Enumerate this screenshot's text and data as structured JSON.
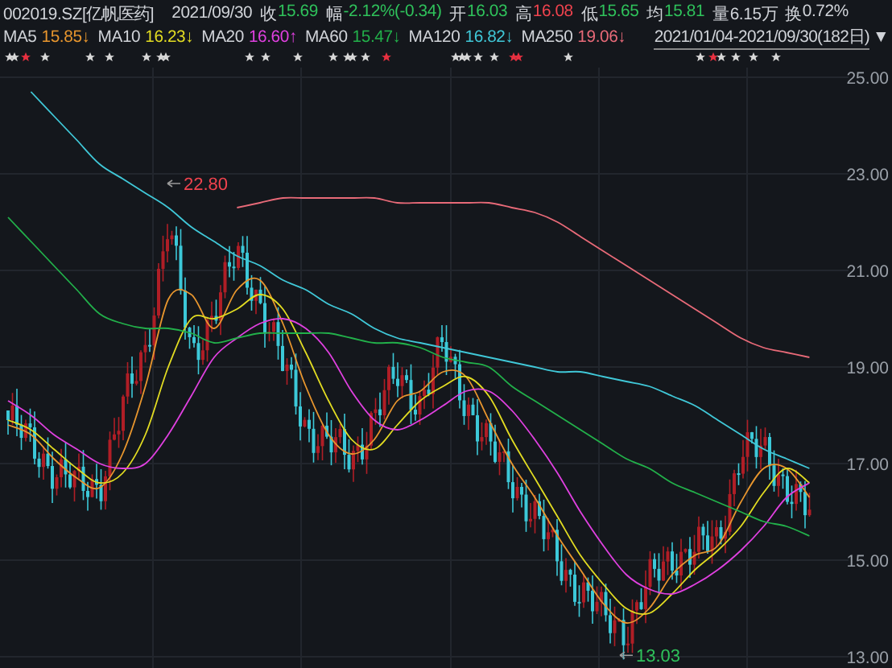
{
  "quote": {
    "symbol": "002019.SZ[亿帆医药]",
    "date": "2021/09/30",
    "fields": [
      {
        "label": "收",
        "value": "15.69",
        "color": "#2fc25b"
      },
      {
        "label": "幅",
        "value": "-2.12%(-0.34)",
        "color": "#2fc25b"
      },
      {
        "label": "开",
        "value": "16.03",
        "color": "#2fc25b"
      },
      {
        "label": "高",
        "value": "16.08",
        "color": "#f0434e"
      },
      {
        "label": "低",
        "value": "15.65",
        "color": "#2fc25b"
      },
      {
        "label": "均",
        "value": "15.81",
        "color": "#2fc25b"
      },
      {
        "label": "量",
        "value": "6.15万",
        "color": "#d0d3d8"
      },
      {
        "label": "换",
        "value": "0.72%",
        "color": "#d0d3d8"
      }
    ]
  },
  "moving_averages": [
    {
      "value": "15.85↓",
      "color": "#e8962e"
    },
    {
      "value": "16.23↓",
      "color": "#e2dc22"
    },
    {
      "value": "16.60↑",
      "color": "#e040e0"
    },
    {
      "value": "15.47↓",
      "color": "#22b04a"
    },
    {
      "value": "16.82↓",
      "color": "#40c8d8"
    },
    {
      "value": "19.06↓",
      "color": "#e86a78"
    }
  ],
  "date_range": {
    "label": "2021/01/04-2021/09/30(182日)",
    "dropdown": "▼"
  },
  "event_markers": [
    {
      "color": "#d8d8d8"
    },
    {
      "color": "#d8d8d8"
    },
    {
      "color": "#e83040"
    },
    {
      "color": "#d8d8d8"
    },
    {
      "color": "#d8d8d8"
    },
    {
      "color": "#d8d8d8"
    },
    {
      "color": "#d8d8d8"
    },
    {
      "color": "#d8d8d8"
    },
    {
      "color": "#d8d8d8"
    },
    {
      "color": "#d8d8d8"
    },
    {
      "color": "#d8d8d8"
    },
    {
      "color": "#d8d8d8"
    },
    {
      "color": "#d8d8d8"
    },
    {
      "color": "#d8d8d8"
    },
    {
      "color": "#d8d8d8"
    },
    {
      "color": "#d8d8d8"
    },
    {
      "color": "#e83040"
    },
    {
      "color": "#d8d8d8"
    },
    {
      "color": "#d8d8d8"
    },
    {
      "color": "#d8d8d8"
    },
    {
      "color": "#d8d8d8"
    },
    {
      "color": "#d8d8d8"
    },
    {
      "color": "#e83040"
    },
    {
      "color": "#e83040"
    },
    {
      "color": "#d8d8d8"
    },
    {
      "color": "#d8d8d8"
    },
    {
      "color": "#e83040"
    },
    {
      "color": "#d8d8d8"
    },
    {
      "color": "#d8d8d8"
    },
    {
      "color": "#d8d8d8"
    },
    {
      "color": "#d8d8d8"
    }
  ],
  "chart": {
    "high_label": "22.80",
    "low_label": "13.03",
    "chart_data": {
      "type": "line",
      "categories": [
        null,
        null,
        null,
        null,
        null,
        null,
        null,
        null,
        null,
        null,
        null,
        null,
        null,
        null,
        null,
        null,
        null,
        null,
        null,
        null,
        null,
        null,
        null,
        null,
        null,
        null,
        null,
        null,
        null,
        null,
        null,
        null,
        null,
        null,
        null,
        null
      ],
      "ylim": [
        13,
        25
      ],
      "grid": true,
      "yticks": [
        {
          "value": 25,
          "label": "25.00"
        },
        {
          "value": 23,
          "label": "23.00"
        },
        {
          "value": 21,
          "label": "21.00"
        },
        {
          "value": 19,
          "label": "19.00"
        },
        {
          "value": 17,
          "label": "17.00"
        },
        {
          "value": 15,
          "label": "15.00"
        },
        {
          "value": 13,
          "label": "13.00"
        }
      ],
      "series": [
        {
          "name": "MA5",
          "color": "#e8962e",
          "values": [
            17.8,
            17.6,
            17.1,
            16.7,
            16.5,
            17.2,
            18.6,
            20.4,
            20.5,
            19.8,
            20.6,
            20.8,
            19.9,
            18.6,
            17.6,
            17.2,
            17.5,
            18.3,
            18.5,
            18.9,
            18.8,
            17.9,
            17.0,
            16.3,
            15.5,
            14.8,
            14.1,
            13.7,
            14.0,
            14.7,
            15.1,
            15.3,
            16.2,
            16.9,
            16.9,
            16.3
          ]
        },
        {
          "name": "MA10",
          "color": "#e2dc22",
          "values": [
            17.9,
            17.7,
            17.3,
            16.9,
            16.6,
            16.8,
            17.6,
            19.0,
            20.0,
            20.0,
            20.2,
            20.5,
            20.2,
            19.3,
            18.3,
            17.5,
            17.3,
            17.8,
            18.3,
            18.6,
            18.8,
            18.4,
            17.5,
            16.7,
            15.9,
            15.1,
            14.5,
            14.0,
            13.9,
            14.3,
            14.8,
            15.2,
            15.7,
            16.4,
            16.9,
            16.6
          ]
        },
        {
          "name": "MA20",
          "color": "#e040e0",
          "values": [
            18.3,
            18.0,
            17.6,
            17.3,
            17.0,
            16.9,
            17.0,
            17.6,
            18.4,
            19.2,
            19.6,
            19.9,
            20.0,
            19.8,
            19.3,
            18.5,
            17.9,
            17.7,
            17.9,
            18.2,
            18.5,
            18.5,
            18.1,
            17.5,
            16.8,
            16.0,
            15.3,
            14.7,
            14.4,
            14.3,
            14.5,
            14.8,
            15.2,
            15.7,
            16.3,
            16.6
          ]
        },
        {
          "name": "MA60",
          "color": "#22b04a",
          "values": [
            22.1,
            21.6,
            21.1,
            20.6,
            20.1,
            19.9,
            19.8,
            19.8,
            19.7,
            19.5,
            19.6,
            19.7,
            19.7,
            19.7,
            19.7,
            19.6,
            19.5,
            19.5,
            19.4,
            19.2,
            19.1,
            19.0,
            18.6,
            18.3,
            18.0,
            17.7,
            17.4,
            17.1,
            16.9,
            16.6,
            16.4,
            16.2,
            16.0,
            15.8,
            15.7,
            15.5
          ]
        },
        {
          "name": "MA120",
          "color": "#40c8d8",
          "values": [
            null,
            24.7,
            24.2,
            23.7,
            23.2,
            22.9,
            22.6,
            22.3,
            21.9,
            21.6,
            21.3,
            21.1,
            20.8,
            20.6,
            20.3,
            20.1,
            19.8,
            19.6,
            19.5,
            19.4,
            19.3,
            19.2,
            19.1,
            19.0,
            18.9,
            18.9,
            18.8,
            18.7,
            18.6,
            18.4,
            18.2,
            17.9,
            17.6,
            17.3,
            17.1,
            16.9
          ]
        },
        {
          "name": "MA250",
          "color": "#e86a78",
          "values": [
            null,
            null,
            null,
            null,
            null,
            null,
            null,
            null,
            null,
            null,
            22.3,
            22.4,
            22.5,
            22.5,
            22.5,
            22.5,
            22.5,
            22.4,
            22.4,
            22.4,
            22.4,
            22.4,
            22.3,
            22.2,
            22.0,
            21.7,
            21.4,
            21.1,
            20.8,
            20.5,
            20.2,
            19.9,
            19.6,
            19.4,
            19.3,
            19.2
          ]
        }
      ]
    }
  }
}
